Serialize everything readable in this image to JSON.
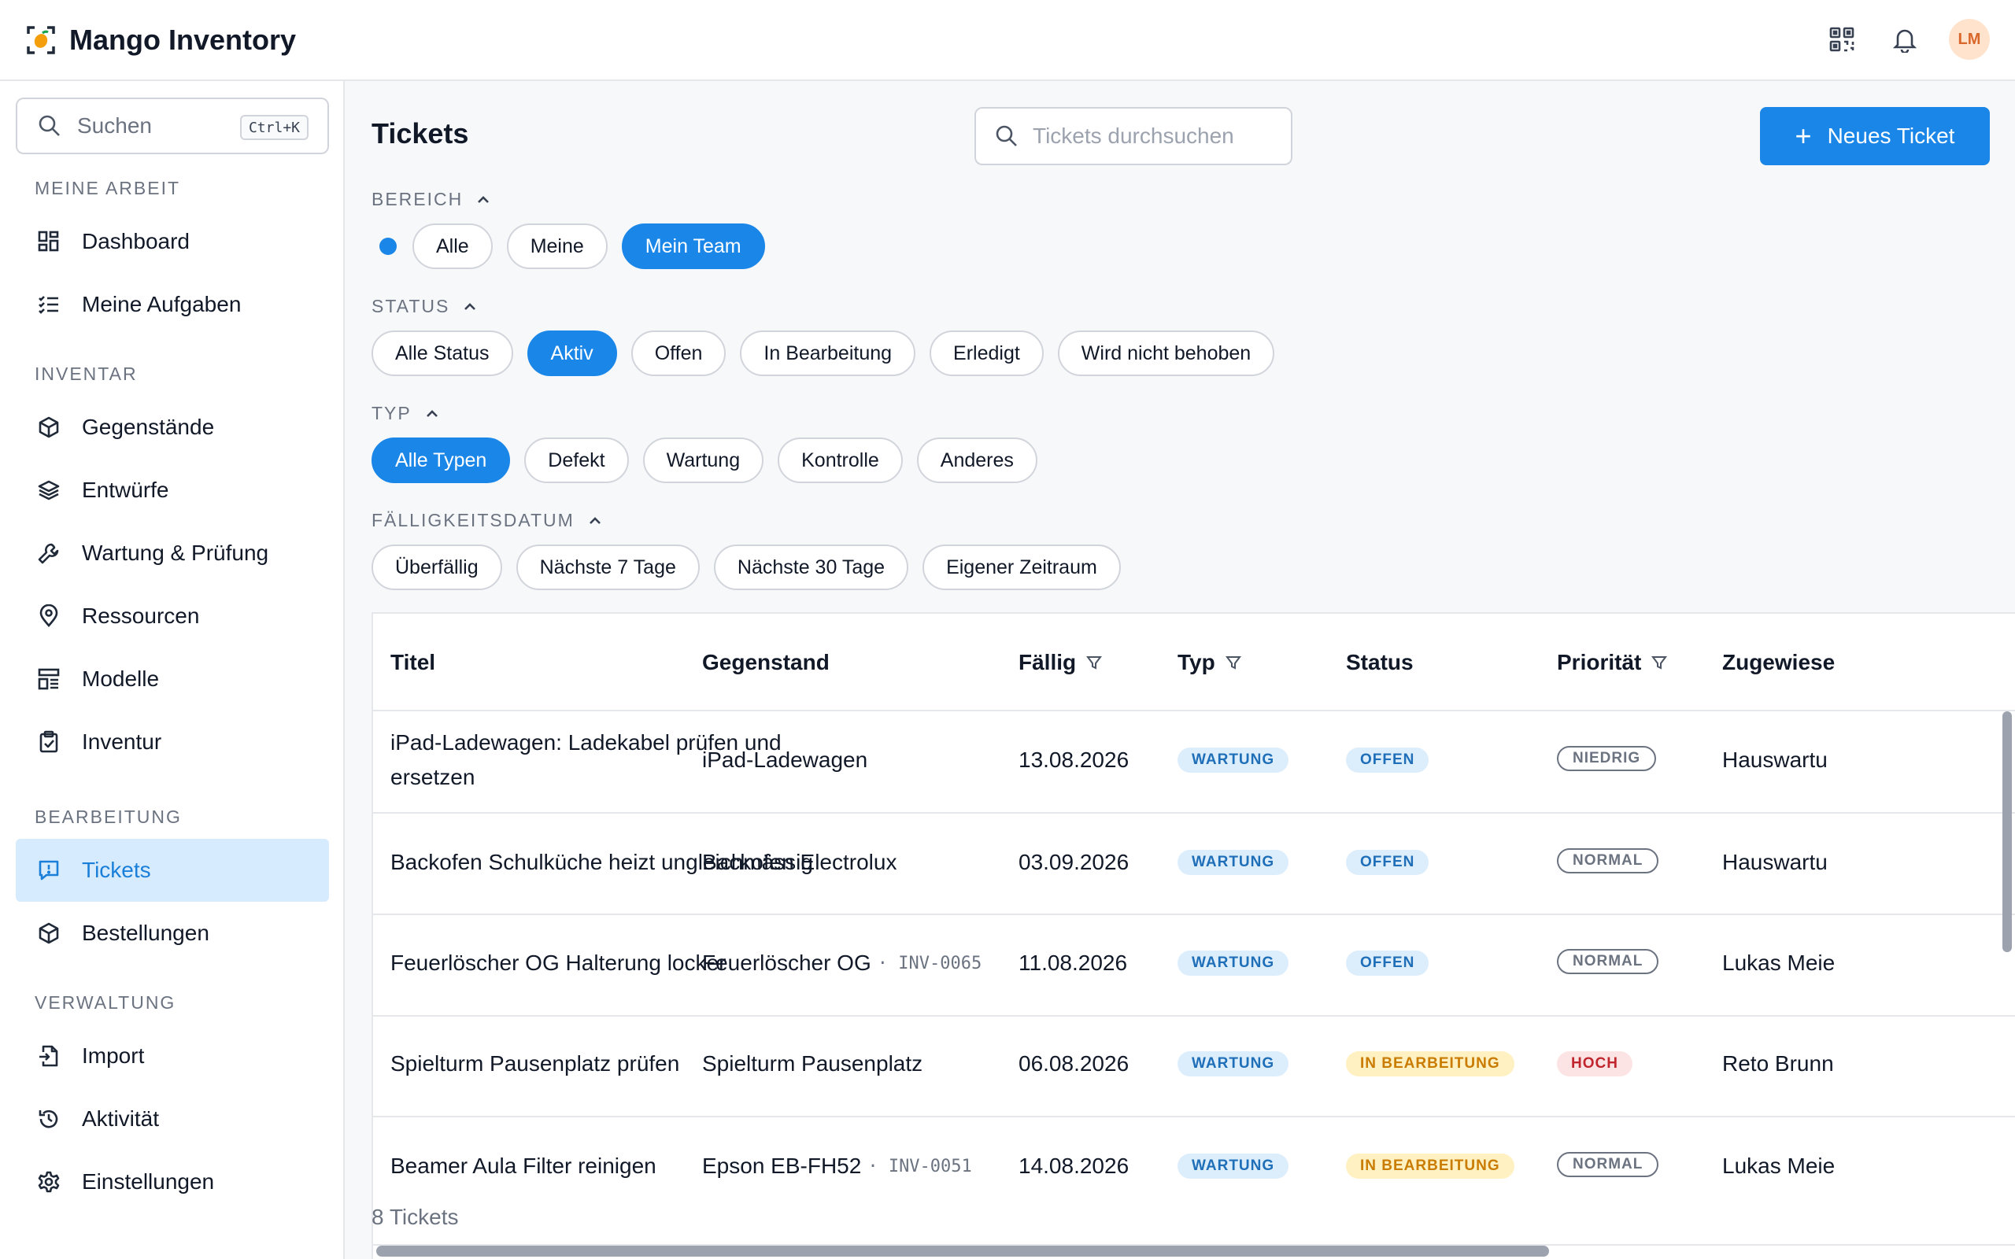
{
  "app": {
    "name": "Mango Inventory",
    "avatar_initials": "LM",
    "accent": "#1a86e8"
  },
  "sidebar": {
    "search_placeholder": "Suchen",
    "search_shortcut": "Ctrl+K",
    "sections": [
      {
        "title": "MEINE ARBEIT",
        "items": [
          {
            "label": "Dashboard",
            "icon": "dashboard-icon"
          },
          {
            "label": "Meine Aufgaben",
            "icon": "task-list-icon"
          }
        ]
      },
      {
        "title": "INVENTAR",
        "items": [
          {
            "label": "Gegenstände",
            "icon": "box-icon"
          },
          {
            "label": "Entwürfe",
            "icon": "layers-icon"
          },
          {
            "label": "Wartung & Prüfung",
            "icon": "wrench-icon"
          },
          {
            "label": "Ressourcen",
            "icon": "location-pin-icon"
          },
          {
            "label": "Modelle",
            "icon": "model-icon"
          },
          {
            "label": "Inventur",
            "icon": "clipboard-check-icon"
          }
        ]
      },
      {
        "title": "BEARBEITUNG",
        "items": [
          {
            "label": "Tickets",
            "icon": "ticket-icon",
            "active": true
          },
          {
            "label": "Bestellungen",
            "icon": "box-icon"
          }
        ]
      },
      {
        "title": "VERWALTUNG",
        "items": [
          {
            "label": "Import",
            "icon": "import-icon"
          },
          {
            "label": "Aktivität",
            "icon": "history-icon"
          },
          {
            "label": "Einstellungen",
            "icon": "gear-icon"
          }
        ]
      }
    ]
  },
  "main": {
    "title": "Tickets",
    "search_placeholder": "Tickets durchsuchen",
    "new_button": "Neues Ticket",
    "filters": {
      "bereich": {
        "label": "BEREICH",
        "chips": [
          "Alle",
          "Meine",
          "Mein Team"
        ],
        "selected": "Mein Team"
      },
      "status": {
        "label": "STATUS",
        "chips": [
          "Alle Status",
          "Aktiv",
          "Offen",
          "In Bearbeitung",
          "Erledigt",
          "Wird nicht behoben"
        ],
        "selected": "Aktiv"
      },
      "typ": {
        "label": "TYP",
        "chips": [
          "Alle Typen",
          "Defekt",
          "Wartung",
          "Kontrolle",
          "Anderes"
        ],
        "selected": "Alle Typen"
      },
      "faellig": {
        "label": "FÄLLIGKEITSDATUM",
        "chips": [
          "Überfällig",
          "Nächste 7 Tage",
          "Nächste 30 Tage",
          "Eigener Zeitraum"
        ],
        "selected": ""
      }
    },
    "table": {
      "columns": [
        "Titel",
        "Gegenstand",
        "Fällig",
        "Typ",
        "Status",
        "Priorität",
        "Zugewiese"
      ],
      "rows": [
        {
          "title": "iPad-Ladewagen: Ladekabel prüfen und ersetzen",
          "item": "iPad-Ladewagen",
          "inv": "",
          "due": "13.08.2026",
          "type": "WARTUNG",
          "status": "OFFEN",
          "priority": "NIEDRIG",
          "assignee": "Hauswartu"
        },
        {
          "title": "Backofen Schulküche heizt ungleichmässig",
          "item": "Backofen Electrolux",
          "inv": "",
          "due": "03.09.2026",
          "type": "WARTUNG",
          "status": "OFFEN",
          "priority": "NORMAL",
          "assignee": "Hauswartu"
        },
        {
          "title": "Feuerlöscher OG Halterung locker",
          "item": "Feuerlöscher OG",
          "inv": "· INV-0065",
          "due": "11.08.2026",
          "type": "WARTUNG",
          "status": "OFFEN",
          "priority": "NORMAL",
          "assignee": "Lukas Meie"
        },
        {
          "title": "Spielturm Pausenplatz prüfen",
          "item": "Spielturm Pausenplatz",
          "inv": "",
          "due": "06.08.2026",
          "type": "WARTUNG",
          "status": "IN BEARBEITUNG",
          "priority": "HOCH",
          "assignee": "Reto Brunn"
        },
        {
          "title": "Beamer Aula Filter reinigen",
          "item": "Epson EB-FH52",
          "inv": "· INV-0051",
          "due": "14.08.2026",
          "type": "WARTUNG",
          "status": "IN BEARBEITUNG",
          "priority": "NORMAL",
          "assignee": "Lukas Meie"
        }
      ]
    },
    "count_text": "8 Tickets"
  }
}
